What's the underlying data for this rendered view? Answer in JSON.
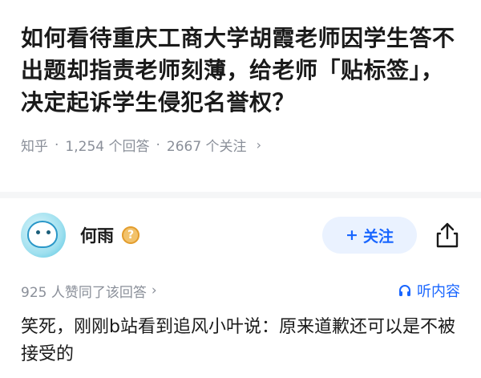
{
  "question": {
    "title": "如何看待重庆工商大学胡霞老师因学生答不出题却指责老师刻薄，给老师「贴标签」，决定起诉学生侵犯名誉权？",
    "source": "知乎",
    "answers_count": "1,254 个回答",
    "followers_count": "2667 个关注"
  },
  "answer": {
    "author_name": "何雨",
    "badge_symbol": "?",
    "follow_label": "关注",
    "likes_text": "925 人赞同了该回答",
    "listen_label": "听内容",
    "content": "笑死，刚刚b站看到追风小叶说：原来道歉还可以是不被接受的"
  },
  "icons": {
    "follow": "plus-icon",
    "share": "share-icon",
    "listen": "headphones-icon",
    "chevron": "chevron-right-icon"
  },
  "colors": {
    "accent": "#1966ff",
    "meta_gray": "#8a8f99",
    "follow_bg": "#eaf2ff"
  }
}
